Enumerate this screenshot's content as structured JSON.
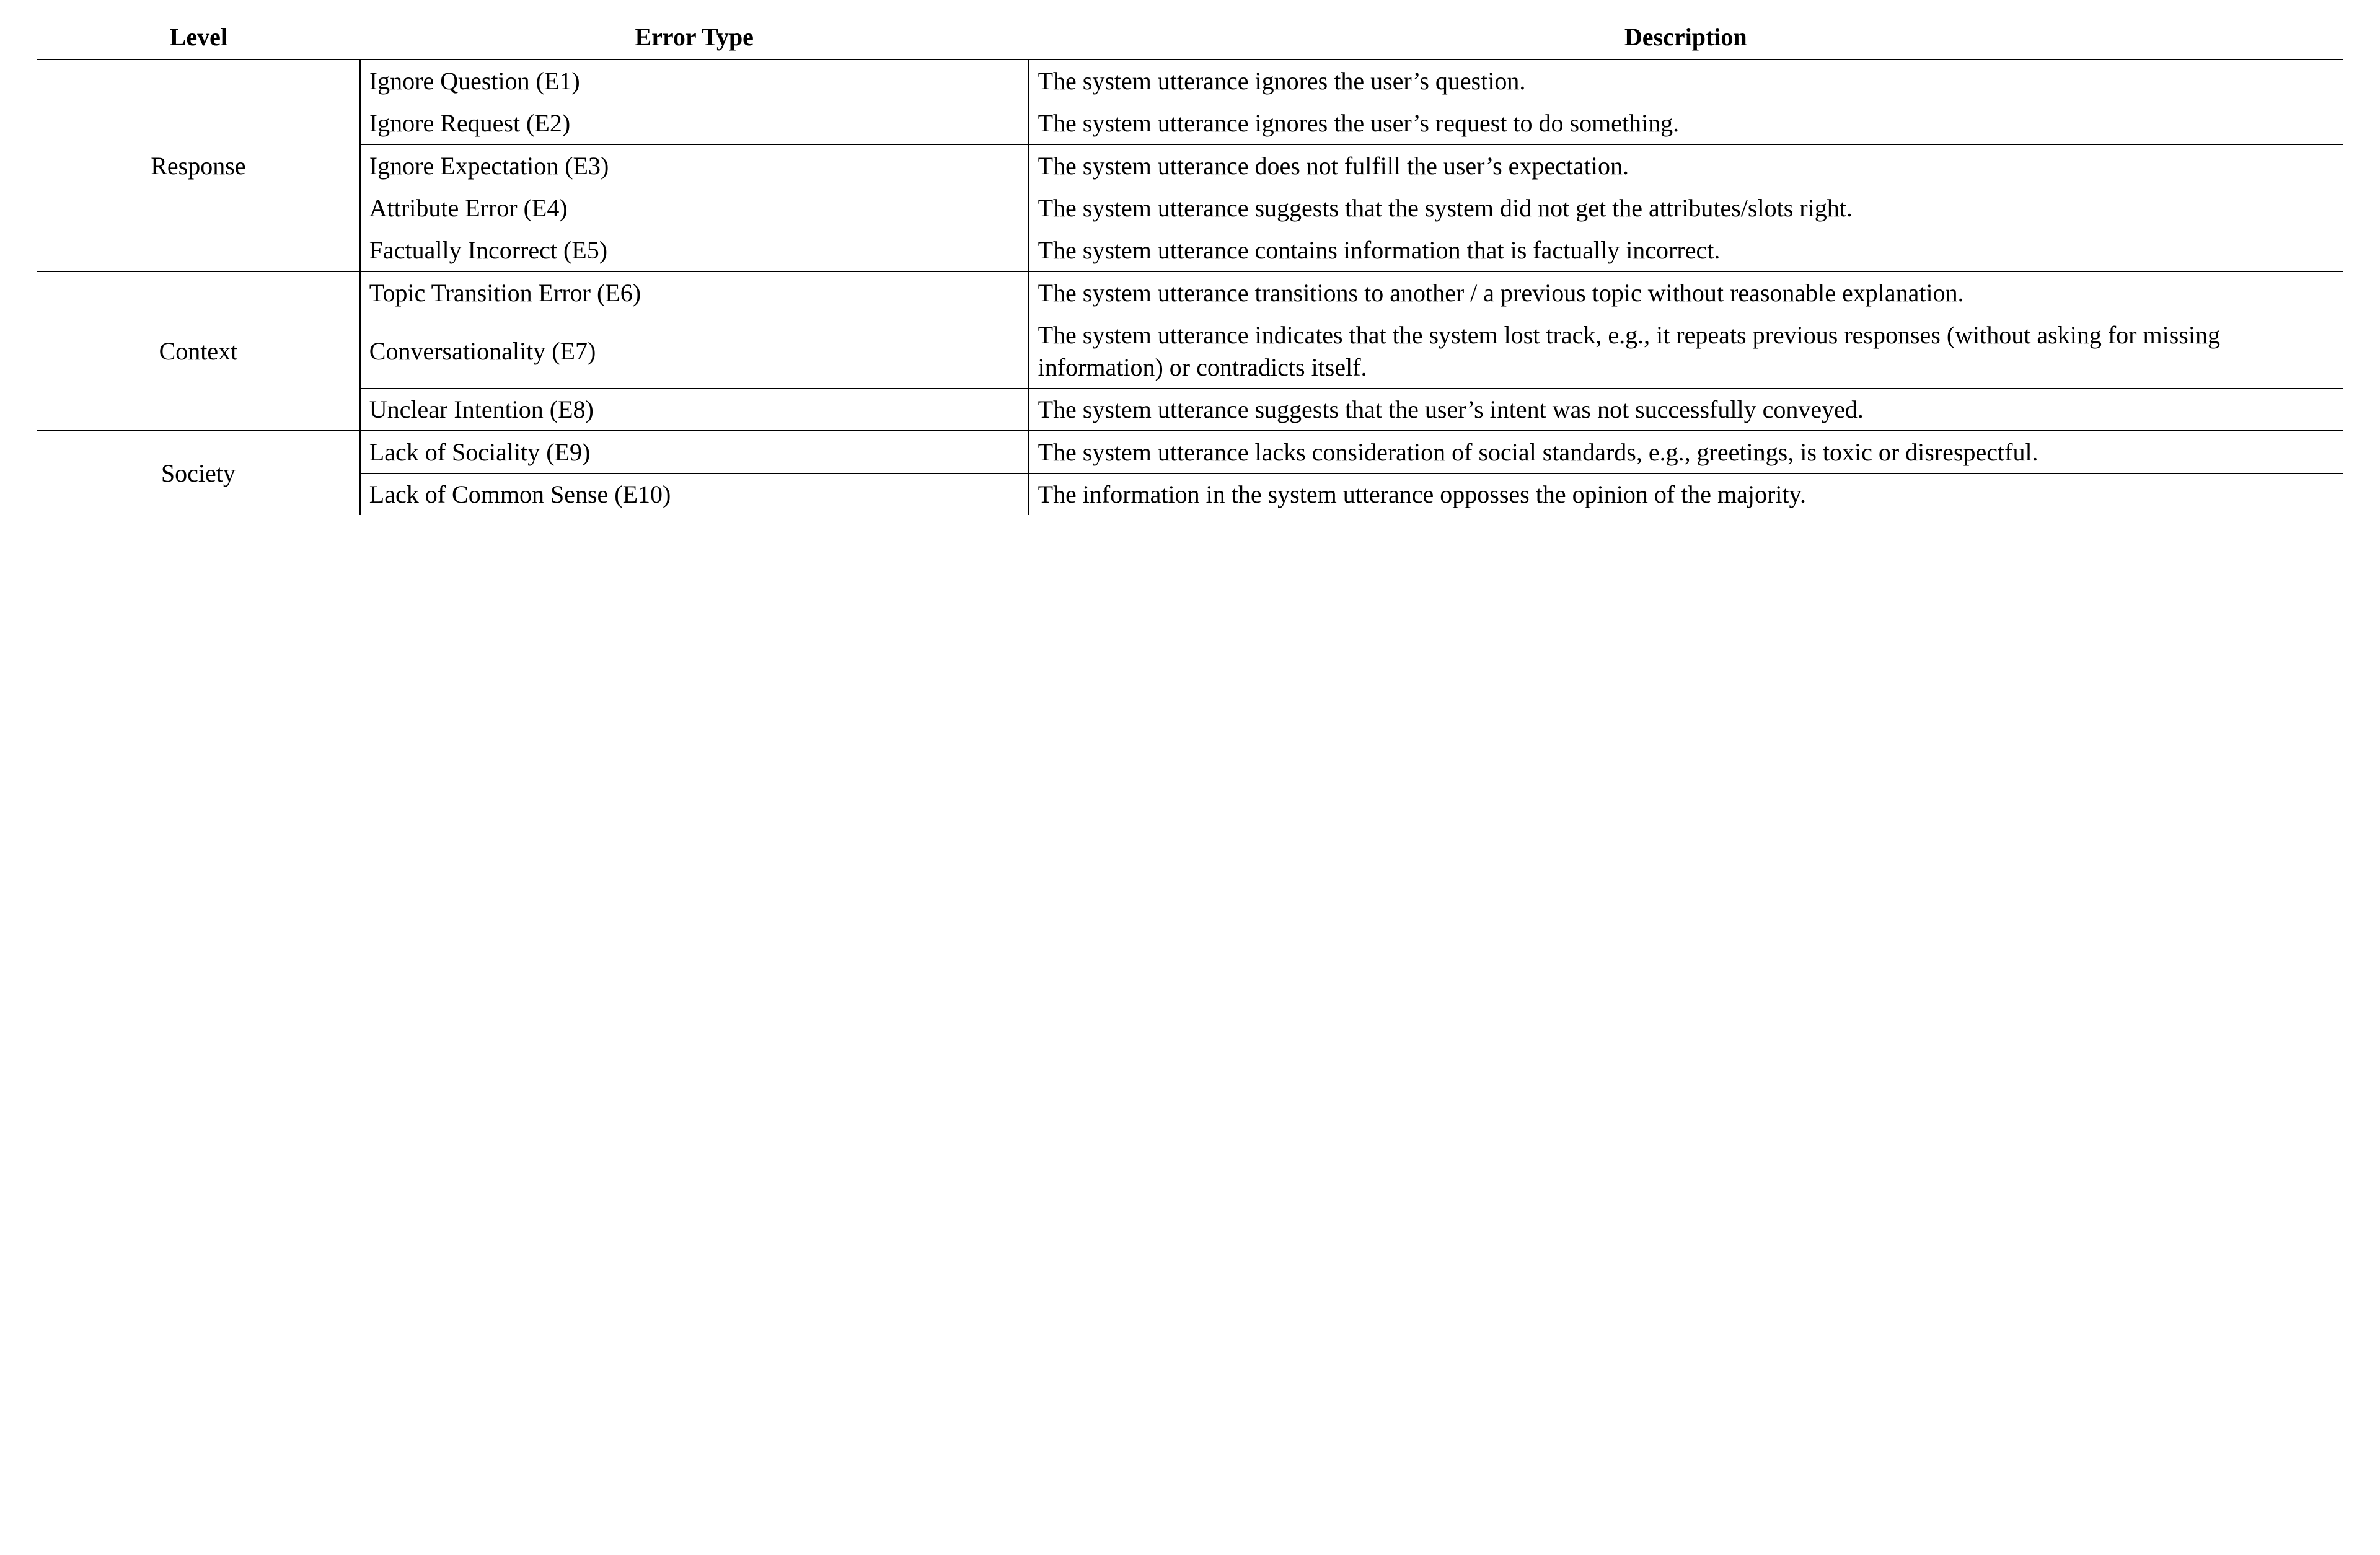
{
  "chart_data": {
    "type": "table",
    "columns": [
      "Level",
      "Error Type",
      "Description"
    ],
    "groups": [
      {
        "level": "Response",
        "rows": [
          {
            "error_type": "Ignore Question (E1)",
            "description": "The system utterance ignores the user’s question."
          },
          {
            "error_type": "Ignore Request (E2)",
            "description": "The system utterance ignores the user’s request to do something."
          },
          {
            "error_type": "Ignore Expectation (E3)",
            "description": "The system utterance does not fulfill the user’s expectation."
          },
          {
            "error_type": "Attribute Error (E4)",
            "description": "The system utterance suggests that the system did not get the attributes/slots right."
          },
          {
            "error_type": "Factually Incorrect (E5)",
            "description": "The system utterance contains information that is factually incorrect."
          }
        ]
      },
      {
        "level": "Context",
        "rows": [
          {
            "error_type": "Topic Transition Error (E6)",
            "description": "The system utterance transitions to another / a previous topic without reasonable explanation."
          },
          {
            "error_type": "Conversationality (E7)",
            "description": "The system utterance indicates that the system lost track, e.g., it repeats previous responses (without asking for missing information) or contradicts itself."
          },
          {
            "error_type": "Unclear Intention (E8)",
            "description": "The system utterance suggests that the user’s intent was not successfully conveyed."
          }
        ]
      },
      {
        "level": "Society",
        "rows": [
          {
            "error_type": "Lack of Sociality (E9)",
            "description": "The system utterance lacks consideration of social standards, e.g., greetings, is toxic or disrespectful."
          },
          {
            "error_type": "Lack of Common Sense (E10)",
            "description": "The information in the system utterance opposses the opinion of the majority."
          }
        ]
      }
    ]
  }
}
